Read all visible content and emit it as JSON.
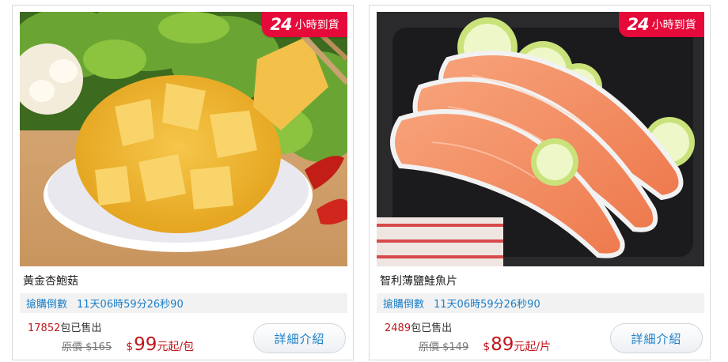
{
  "products": [
    {
      "badge": {
        "num": "24",
        "text": "小時到貨"
      },
      "name": "黃金杏鮑菇",
      "countdown_label": "搶購倒數",
      "countdown": "11天06時59分26秒90",
      "sold_count": "17852",
      "sold_suffix": "包已售出",
      "orig_price": "原價 $165",
      "currency": "$",
      "price": "99",
      "unit": "元起/包",
      "button": "詳細介紹"
    },
    {
      "badge": {
        "num": "24",
        "text": "小時到貨"
      },
      "name": "智利薄鹽鮭魚片",
      "countdown_label": "搶購倒數",
      "countdown": "11天06時59分26秒90",
      "sold_count": "2489",
      "sold_suffix": "包已售出",
      "orig_price": "原價 $149",
      "currency": "$",
      "price": "89",
      "unit": "元起/片",
      "button": "詳細介紹"
    }
  ],
  "colors": {
    "badge": "#e50a3a",
    "countdown_text": "#1a7fc8",
    "price": "#c0171c",
    "countdown_bg": "#f2f2f2"
  }
}
